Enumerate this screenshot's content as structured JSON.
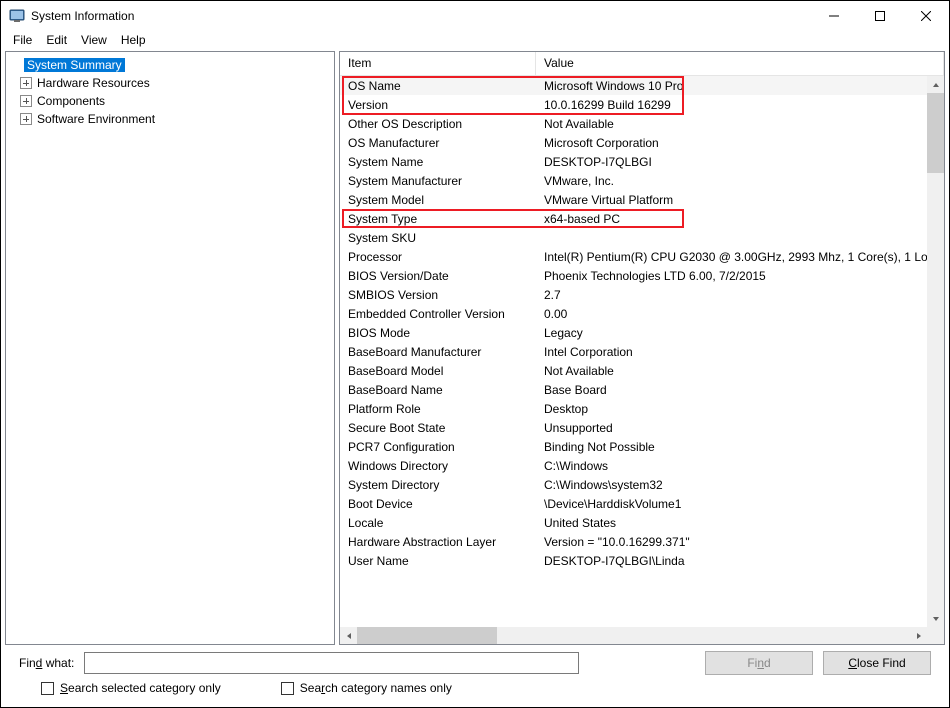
{
  "window": {
    "title": "System Information"
  },
  "menu": {
    "file": "File",
    "edit": "Edit",
    "view": "View",
    "help": "Help"
  },
  "tree": {
    "root": "System Summary",
    "items": [
      "Hardware Resources",
      "Components",
      "Software Environment"
    ]
  },
  "columns": {
    "item": "Item",
    "value": "Value"
  },
  "rows": [
    {
      "item": "OS Name",
      "value": "Microsoft Windows 10 Pro"
    },
    {
      "item": "Version",
      "value": "10.0.16299 Build 16299"
    },
    {
      "item": "Other OS Description",
      "value": "Not Available"
    },
    {
      "item": "OS Manufacturer",
      "value": "Microsoft Corporation"
    },
    {
      "item": "System Name",
      "value": "DESKTOP-I7QLBGI"
    },
    {
      "item": "System Manufacturer",
      "value": "VMware, Inc."
    },
    {
      "item": "System Model",
      "value": "VMware Virtual Platform"
    },
    {
      "item": "System Type",
      "value": "x64-based PC"
    },
    {
      "item": "System SKU",
      "value": ""
    },
    {
      "item": "Processor",
      "value": "Intel(R) Pentium(R) CPU G2030 @ 3.00GHz, 2993 Mhz, 1 Core(s), 1 Lo"
    },
    {
      "item": "BIOS Version/Date",
      "value": "Phoenix Technologies LTD 6.00, 7/2/2015"
    },
    {
      "item": "SMBIOS Version",
      "value": "2.7"
    },
    {
      "item": "Embedded Controller Version",
      "value": "0.00"
    },
    {
      "item": "BIOS Mode",
      "value": "Legacy"
    },
    {
      "item": "BaseBoard Manufacturer",
      "value": "Intel Corporation"
    },
    {
      "item": "BaseBoard Model",
      "value": "Not Available"
    },
    {
      "item": "BaseBoard Name",
      "value": "Base Board"
    },
    {
      "item": "Platform Role",
      "value": "Desktop"
    },
    {
      "item": "Secure Boot State",
      "value": "Unsupported"
    },
    {
      "item": "PCR7 Configuration",
      "value": "Binding Not Possible"
    },
    {
      "item": "Windows Directory",
      "value": "C:\\Windows"
    },
    {
      "item": "System Directory",
      "value": "C:\\Windows\\system32"
    },
    {
      "item": "Boot Device",
      "value": "\\Device\\HarddiskVolume1"
    },
    {
      "item": "Locale",
      "value": "United States"
    },
    {
      "item": "Hardware Abstraction Layer",
      "value": "Version = \"10.0.16299.371\""
    },
    {
      "item": "User Name",
      "value": "DESKTOP-I7QLBGI\\Linda"
    }
  ],
  "find": {
    "label": "Find what:",
    "find_btn": "Find",
    "close_btn": "Close Find",
    "cb1": "Search selected category only",
    "cb2": "Search category names only"
  }
}
